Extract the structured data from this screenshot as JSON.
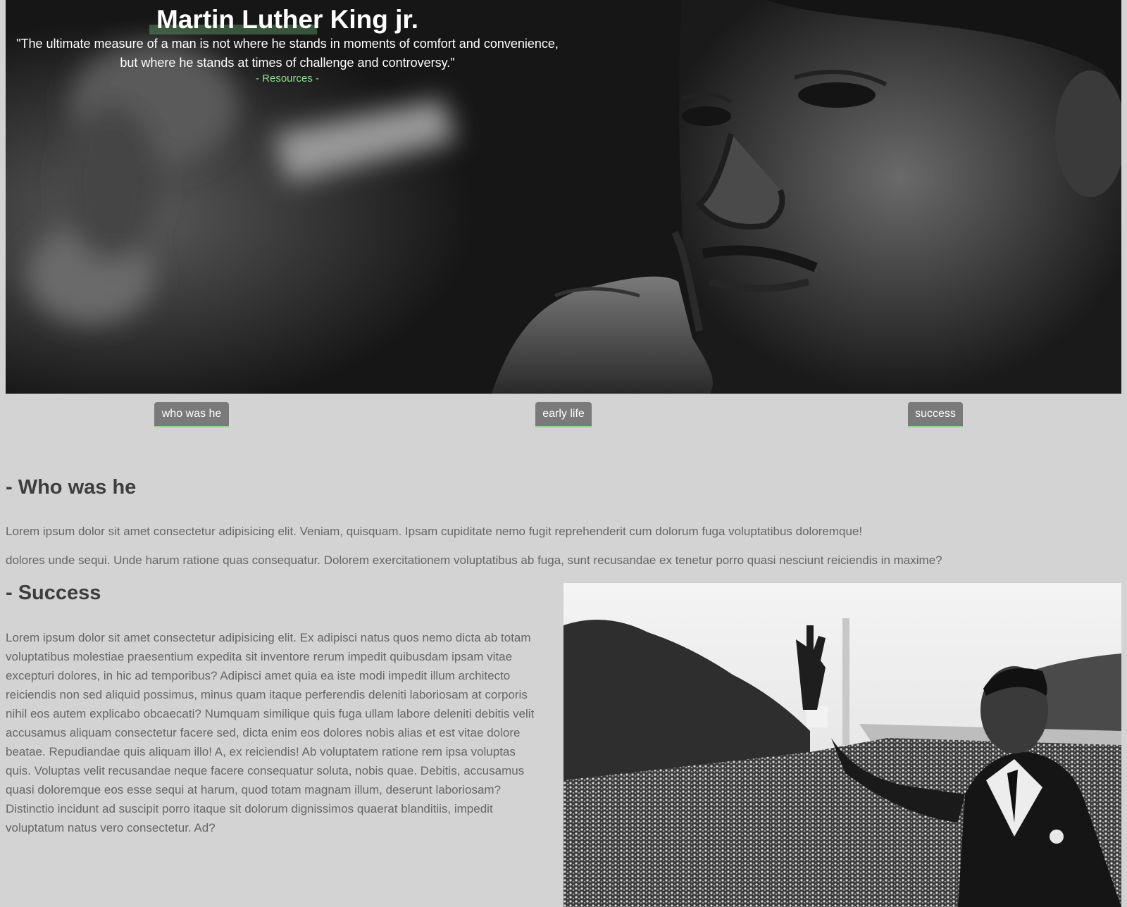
{
  "header": {
    "title": "Martin Luther King jr.",
    "quote_line1": "\"The ultimate measure of a man is not where he stands in moments of comfort and convenience,",
    "quote_line2": "but where he stands at times of challenge and controversy.\"",
    "source": "- Resources -"
  },
  "nav": {
    "items": [
      {
        "label": "who was he"
      },
      {
        "label": "early life"
      },
      {
        "label": "success"
      }
    ]
  },
  "who": {
    "title": "- Who was he",
    "p1": "Lorem ipsum dolor sit amet consectetur adipisicing elit. Veniam, quisquam. Ipsam cupiditate nemo fugit reprehenderit cum dolorum fuga voluptatibus doloremque!",
    "p2": "dolores unde sequi. Unde harum ratione quas consequatur. Dolorem exercitationem voluptatibus ab fuga, sunt recusandae ex tenetur porro quasi nesciunt reiciendis in maxime?"
  },
  "success": {
    "title": "- Success",
    "text": "Lorem ipsum dolor sit amet consectetur adipisicing elit. Ex adipisci natus quos nemo dicta ab totam voluptatibus molestiae praesentium expedita sit inventore rerum impedit quibusdam ipsam vitae excepturi dolores, in hic ad temporibus? Adipisci amet quia ea iste modi impedit illum architecto reiciendis non sed aliquid possimus, minus quam itaque perferendis deleniti laboriosam at corporis nihil eos autem explicabo obcaecati? Numquam similique quis fuga ullam labore deleniti debitis velit accusamus aliquam consectetur facere sed, dicta enim eos dolores nobis alias et est vitae dolore beatae. Repudiandae quis aliquam illo! A, ex reiciendis! Ab voluptatem ratione rem ipsa voluptas quis. Voluptas velit recusandae neque facere consequatur soluta, nobis quae. Debitis, accusamus quasi doloremque eos esse sequi at harum, quod totam magnam illum, deserunt laboriosam? Distinctio incidunt ad suscipit porro itaque sit dolorum dignissimos quaerat blanditiis, impedit voluptatum natus vero consectetur. Ad?"
  },
  "colors": {
    "page_bg": "#d3d3d3",
    "nav_button": "#7a7a7a",
    "accent_green": "#8ee08e",
    "heading": "#3e3e3e",
    "body_text": "#666666"
  }
}
